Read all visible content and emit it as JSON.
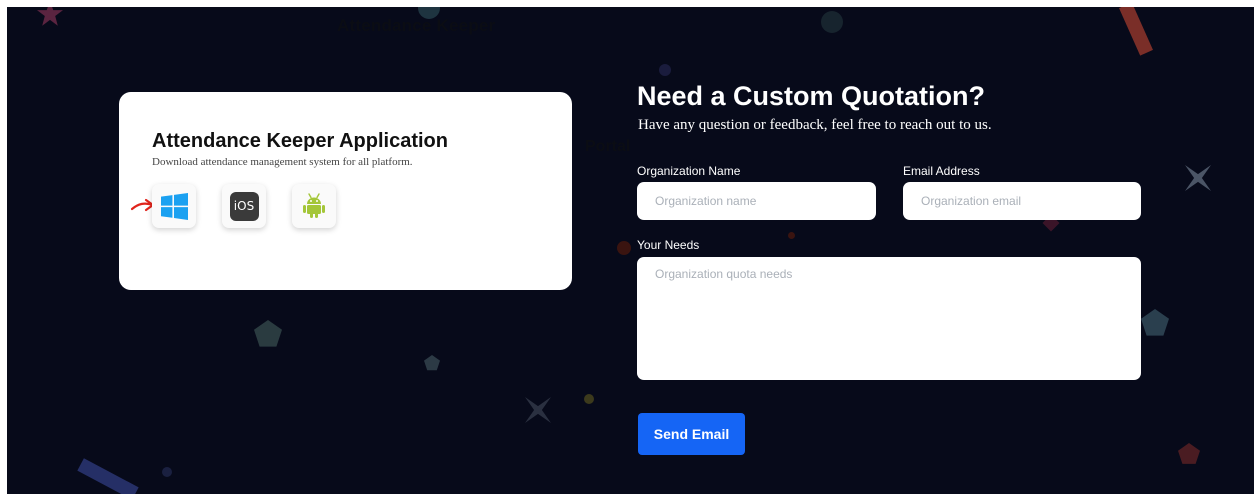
{
  "background": {
    "ghost_title": "Attendance Keeper",
    "ghost_portal": "Portal"
  },
  "app_card": {
    "title": "Attendance Keeper Application",
    "subtitle": "Download attendance management system for all platform.",
    "platforms": [
      {
        "name": "Windows",
        "icon": "windows-icon",
        "color": "#1ba1f1"
      },
      {
        "name": "iOS",
        "icon": "ios-icon",
        "label": "iOS",
        "color": "#3a3a3a"
      },
      {
        "name": "Android",
        "icon": "android-icon",
        "color": "#a4c639"
      }
    ]
  },
  "form": {
    "heading": "Need a Custom Quotation?",
    "subheading": "Have any question or feedback, feel free to reach out to us.",
    "org_name_label": "Organization Name",
    "org_name_placeholder": "Organization name",
    "email_label": "Email Address",
    "email_placeholder": "Organization email",
    "needs_label": "Your Needs",
    "needs_placeholder": "Organization quota needs",
    "submit_label": "Send Email"
  },
  "colors": {
    "background": "#070a1a",
    "accent": "#1565f5",
    "card": "#ffffff"
  }
}
